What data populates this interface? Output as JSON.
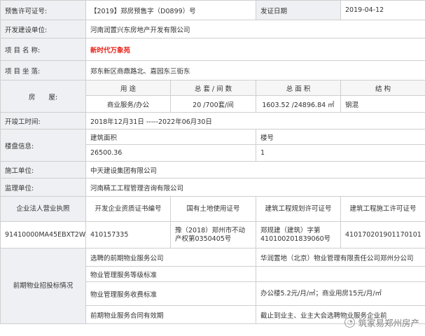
{
  "permit": {
    "permit_no_label": "预售许可证号:",
    "permit_no_value": "【2019】郑房预售字（D0899）号",
    "issue_date_label": "发证日期",
    "issue_date_value": "2019-04-12",
    "developer_label": "开发建设单位:",
    "developer_value": "河南润置兴东房地产开发有限公司",
    "project_name_label": "项 目 名 称:",
    "project_name_value": "新时代万象苑",
    "location_label": "项 目 坐 落:",
    "location_value": "郑东新区商鼎路北、嘉园东三街东",
    "housing_label": "房　　屋:",
    "housing_headers": [
      "用 途",
      "总 套 / 间 数",
      "总 面 积",
      "结 构"
    ],
    "housing_row": [
      "商业服务/办公",
      "20 /700套/间",
      "1603.52 /24896.84 ㎡",
      "钢混"
    ],
    "construction_period_label": "开竣工时间:",
    "construction_period_value": "2018年12月31日 -----2022年06月30日",
    "building_label": "楼盘信息:",
    "building_headers": [
      "建筑面积",
      "楼号"
    ],
    "building_row": [
      "26500.36",
      "1"
    ],
    "contractor_label": "施工单位:",
    "contractor_value": "中天建设集团有限公司",
    "supervisor_label": "监理单位:",
    "supervisor_value": "河南精工工程管理咨询有限公司",
    "license_headers": [
      "企业法人营业执照",
      "开发企业资质证书编号",
      "国有土地使用证号",
      "建筑工程规划许可证号",
      "建筑工程施工许可证号"
    ],
    "license_values": [
      "91410000MA45EBXT2W",
      "410157335",
      "豫（2018）郑州市不动产权第0350405号",
      "郑规建（建筑）字第410100201839060号",
      "410170201901170101"
    ],
    "property_mgmt_label": "前期物业招投标情况",
    "property_mgmt_rows": [
      {
        "label": "选聘的前期物业服务公司",
        "value": "华润置地（北京）物业管理有限责任公司郑州分公司"
      },
      {
        "label": "物业管理服务等级标准",
        "value": ""
      },
      {
        "label": "物业管理服务收费标准",
        "value": "办公楼5.2元/月/㎡；商业用房15元/月/㎡"
      },
      {
        "label": "前期物业服务合同有效期",
        "value": "截止到业主、业主大会选聘物业服务企业前"
      }
    ]
  },
  "watermark": {
    "text": "筑家易郑州房产",
    "icon": "wechat-logo-icon"
  },
  "colors": {
    "label_bg": "#eef0f3",
    "border": "#cfcfcf",
    "project_name": "#e8261c"
  }
}
